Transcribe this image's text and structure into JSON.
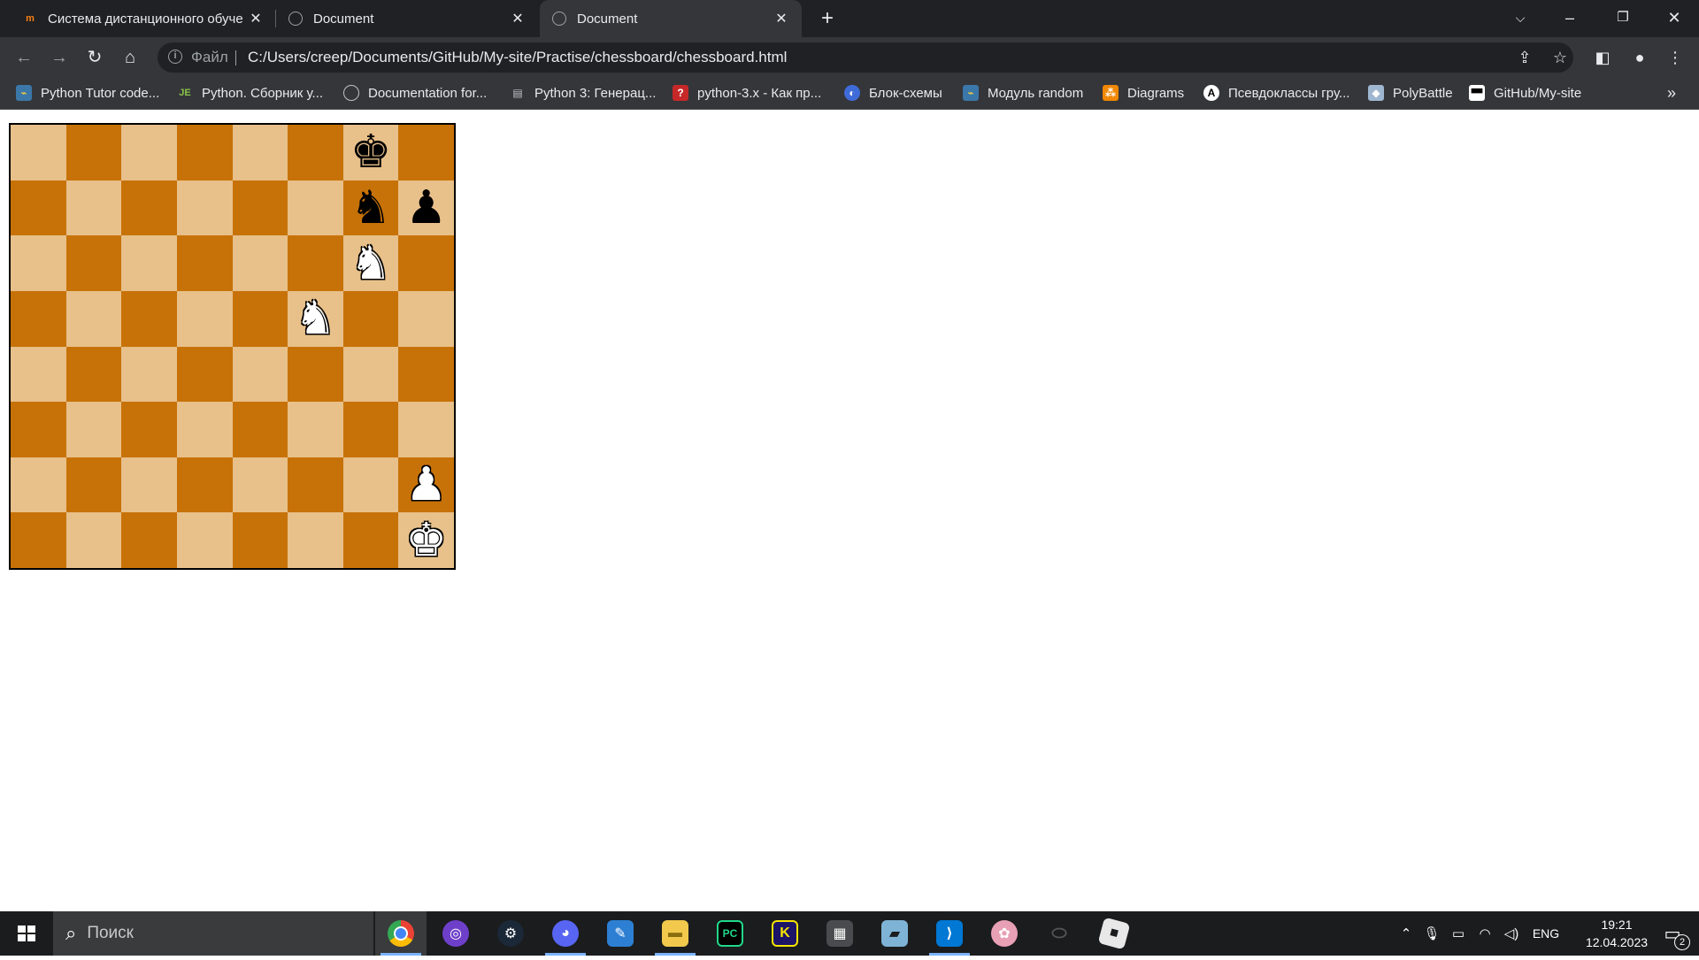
{
  "tabs": [
    {
      "title": "Система дистанционного обуче",
      "icon": "moodle-icon",
      "active": false
    },
    {
      "title": "Document",
      "icon": "globe-icon",
      "active": false
    },
    {
      "title": "Document",
      "icon": "globe-icon",
      "active": true
    }
  ],
  "address": {
    "scheme_label": "Файл",
    "url": "C:/Users/creep/Documents/GitHub/My-site/Practise/chessboard/chessboard.html"
  },
  "bookmarks": [
    {
      "label": "Python Tutor code...",
      "icon": "python-icon"
    },
    {
      "label": "Python. Сборник у...",
      "icon": "je-icon"
    },
    {
      "label": "Documentation for...",
      "icon": "globe-icon"
    },
    {
      "label": "Python 3: Генерац...",
      "icon": "book-icon"
    },
    {
      "label": "python-3.x - Как пр...",
      "icon": "question-icon"
    },
    {
      "label": "Блок-схемы",
      "icon": "flowchart-icon"
    },
    {
      "label": "Модуль random",
      "icon": "python-icon"
    },
    {
      "label": "Diagrams",
      "icon": "diagrams-icon"
    },
    {
      "label": "Псевдоклассы гру...",
      "icon": "a-icon"
    },
    {
      "label": "PolyBattle",
      "icon": "polybattle-icon"
    },
    {
      "label": "GitHub/My-site",
      "icon": "github-icon"
    }
  ],
  "bookmarks_overflow": "»",
  "board": {
    "light_color": "#e8c08a",
    "dark_color": "#c77208",
    "rows": [
      [
        "",
        "",
        "",
        "",
        "",
        "",
        "bk",
        ""
      ],
      [
        "",
        "",
        "",
        "",
        "",
        "",
        "bn",
        "bp"
      ],
      [
        "",
        "",
        "",
        "",
        "",
        "",
        "wn",
        ""
      ],
      [
        "",
        "",
        "",
        "",
        "",
        "wn",
        "",
        ""
      ],
      [
        "",
        "",
        "",
        "",
        "",
        "",
        "",
        ""
      ],
      [
        "",
        "",
        "",
        "",
        "",
        "",
        "",
        ""
      ],
      [
        "",
        "",
        "",
        "",
        "",
        "",
        "",
        "wp"
      ],
      [
        "",
        "",
        "",
        "",
        "",
        "",
        "",
        "wk"
      ]
    ],
    "piece_glyphs": {
      "bk": "♚",
      "bn": "♞",
      "bp": "♟",
      "wk": "♚",
      "wn": "♞",
      "wp": "♟"
    },
    "piece_names": {
      "bk": "black-king",
      "bn": "black-knight",
      "bp": "black-pawn",
      "wk": "white-king",
      "wn": "white-knight",
      "wp": "white-pawn"
    }
  },
  "taskbar": {
    "search_placeholder": "Поиск",
    "apps": [
      "chrome",
      "github-desktop",
      "steam",
      "discord",
      "paint",
      "file-explorer",
      "pycharm",
      "kotlin",
      "calculator",
      "notes",
      "vscode",
      "paint-3d",
      "mouse",
      "roblox"
    ],
    "language": "ENG",
    "time": "19:21",
    "date": "12.04.2023",
    "notification_count": "2"
  }
}
